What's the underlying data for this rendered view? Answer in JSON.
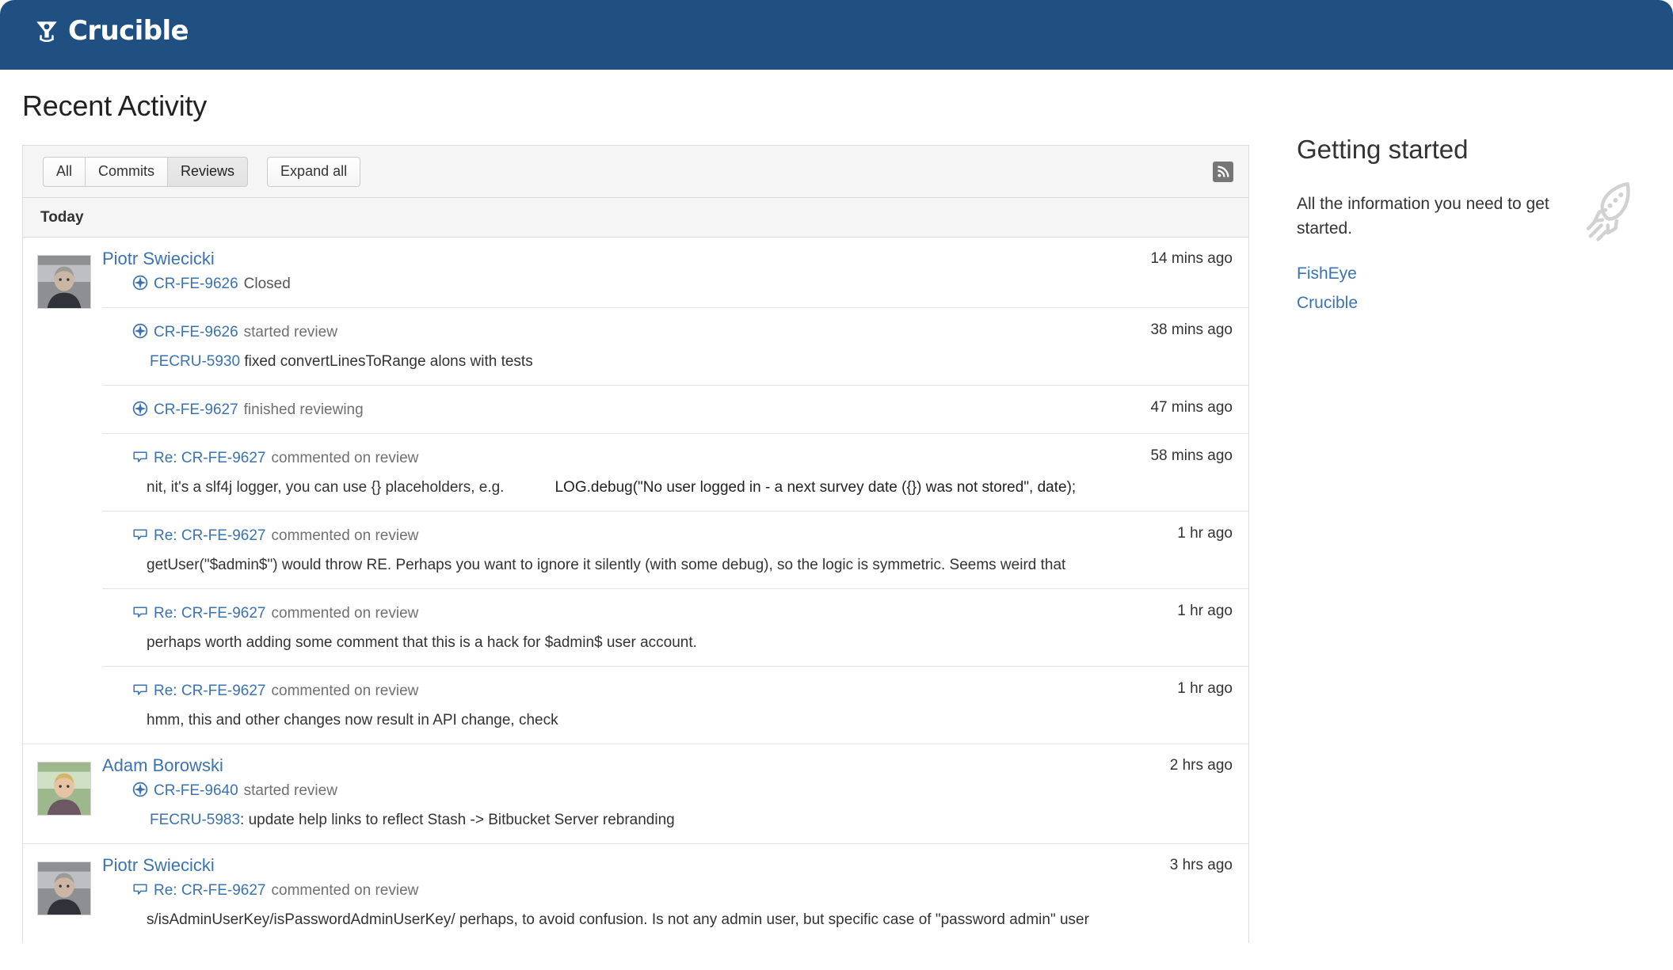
{
  "app": {
    "name": "Crucible",
    "banner_color": "#205081",
    "link_color": "#3b73af"
  },
  "page": {
    "title": "Recent Activity"
  },
  "toolbar": {
    "filters": [
      {
        "label": "All",
        "selected": false
      },
      {
        "label": "Commits",
        "selected": false
      },
      {
        "label": "Reviews",
        "selected": true
      }
    ],
    "expand_all_label": "Expand all",
    "feed_icon": "rss-feed-icon"
  },
  "activity": {
    "day_header": "Today",
    "groups": [
      {
        "actor": "Piotr Swiecicki",
        "avatar": "piotr-swiecicki-avatar",
        "rows": [
          {
            "icon": "review-icon",
            "entity": "CR-FE-9626",
            "action": "Closed",
            "timestamp": "14 mins ago",
            "detail": null,
            "code": null
          },
          {
            "icon": "review-icon",
            "entity": "CR-FE-9626",
            "action": "started review",
            "timestamp": "38 mins ago",
            "detail_link": "FECRU-5930",
            "detail": " fixed convertLinesToRange alons with tests",
            "code": null
          },
          {
            "icon": "review-icon",
            "entity": "CR-FE-9627",
            "action": "finished reviewing",
            "timestamp": "47 mins ago",
            "detail": null,
            "code": null
          },
          {
            "icon": "comment-icon",
            "entity": "Re: CR-FE-9627",
            "action": "commented on review",
            "timestamp": "58 mins ago",
            "detail": "nit, it's a slf4j logger, you can use {} placeholders, e.g.",
            "code": "LOG.debug(\"No user logged in - a next survey date ({}) was not stored\", date);"
          },
          {
            "icon": "comment-icon",
            "entity": "Re: CR-FE-9627",
            "action": "commented on review",
            "timestamp": "1 hr ago",
            "detail": "getUser(\"$admin$\") would throw RE. Perhaps you want to ignore it silently (with some debug), so the logic is symmetric. Seems weird that",
            "code": null
          },
          {
            "icon": "comment-icon",
            "entity": "Re: CR-FE-9627",
            "action": "commented on review",
            "timestamp": "1 hr ago",
            "detail": "perhaps worth adding some comment that this is a hack for $admin$ user account.",
            "code": null
          },
          {
            "icon": "comment-icon",
            "entity": "Re: CR-FE-9627",
            "action": "commented on review",
            "timestamp": "1 hr ago",
            "detail": "hmm, this and other changes now result in API change, check",
            "code": null
          }
        ]
      },
      {
        "actor": "Adam Borowski",
        "avatar": "adam-borowski-avatar",
        "rows": [
          {
            "icon": "review-icon",
            "entity": "CR-FE-9640",
            "action": "started review",
            "timestamp": "2 hrs ago",
            "detail_link": "FECRU-5983",
            "detail": ": update help links to reflect Stash -> Bitbucket Server rebranding",
            "code": null
          }
        ]
      },
      {
        "actor": "Piotr Swiecicki",
        "avatar": "piotr-swiecicki-avatar",
        "rows": [
          {
            "icon": "comment-icon",
            "entity": "Re: CR-FE-9627",
            "action": "commented on review",
            "timestamp": "3 hrs ago",
            "detail": "s/isAdminUserKey/isPasswordAdminUserKey/ perhaps, to avoid confusion. Is not any admin user, but specific case of \"password admin\" user",
            "code": null
          }
        ]
      }
    ]
  },
  "sidebar": {
    "heading": "Getting started",
    "description": "All the information you need to get started.",
    "icon": "rocket-icon",
    "links": [
      {
        "label": "FishEye"
      },
      {
        "label": "Crucible"
      }
    ]
  }
}
